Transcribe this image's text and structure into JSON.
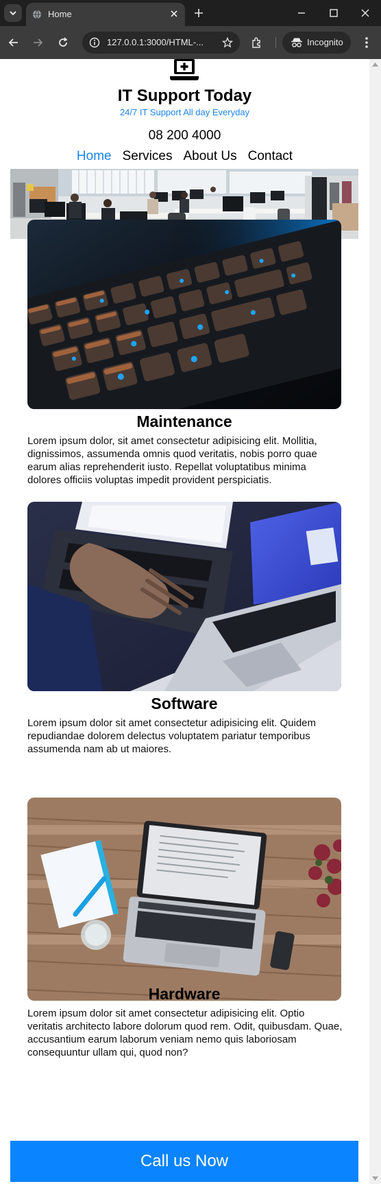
{
  "browser": {
    "tab_title": "Home",
    "url": "127.0.0.1:3000/HTML-...",
    "incognito_label": "Incognito"
  },
  "site": {
    "title": "IT Support Today",
    "tagline": "24/7 IT Support All day Everyday",
    "phone": "08 200 4000",
    "nav": [
      "Home",
      "Services",
      "About Us",
      "Contact"
    ],
    "active_nav": "Home"
  },
  "cards": [
    {
      "title": "Maintenance",
      "image": "keyboard-photo",
      "body": "Lorem ipsum dolor, sit amet consectetur adipisicing elit. Mollitia, dignissimos, assumenda omnis quod veritatis, nobis porro quae earum alias reprehenderit iusto. Repellat voluptatibus minima dolores officiis voluptas impedit provident perspiciatis."
    },
    {
      "title": "Software",
      "image": "laptops-photo",
      "body": "Lorem ipsum dolor sit amet consectetur adipisicing elit. Quidem repudiandae dolorem delectus voluptatem pariatur temporibus assumenda nam ab ut maiores."
    },
    {
      "title": "Hardware",
      "image": "desk-laptop-photo",
      "body": "Lorem ipsum dolor sit amet consectetur adipisicing elit. Optio veritatis architecto labore dolorum quod rem. Odit, quibusdam. Quae, accusantium earum laborum veniam nemo quis laboriosam consequuntur ullam qui, quod non?"
    }
  ],
  "cta": {
    "label": "Call us Now"
  },
  "colors": {
    "accent": "#1a85f0",
    "cta": "#0a84ff",
    "chrome": "#3c3c3c"
  }
}
